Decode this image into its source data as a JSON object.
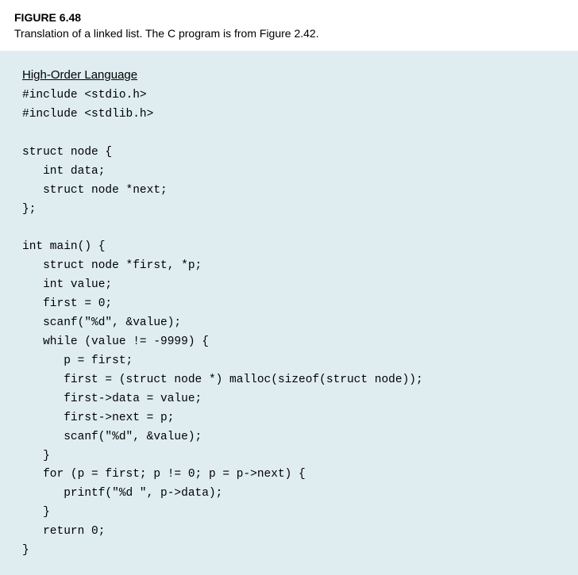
{
  "header": {
    "figure_num": "FIGURE 6.48",
    "caption": "Translation of a linked list. The C program is from Figure 2.42."
  },
  "section": {
    "title": "High-Order Language"
  },
  "code": {
    "text": "#include <stdio.h>\n#include <stdlib.h>\n\nstruct node {\n   int data;\n   struct node *next;\n};\n\nint main() {\n   struct node *first, *p;\n   int value;\n   first = 0;\n   scanf(\"%d\", &value);\n   while (value != -9999) {\n      p = first;\n      first = (struct node *) malloc(sizeof(struct node));\n      first->data = value;\n      first->next = p;\n      scanf(\"%d\", &value);\n   }\n   for (p = first; p != 0; p = p->next) {\n      printf(\"%d \", p->data);\n   }\n   return 0;\n}"
  }
}
